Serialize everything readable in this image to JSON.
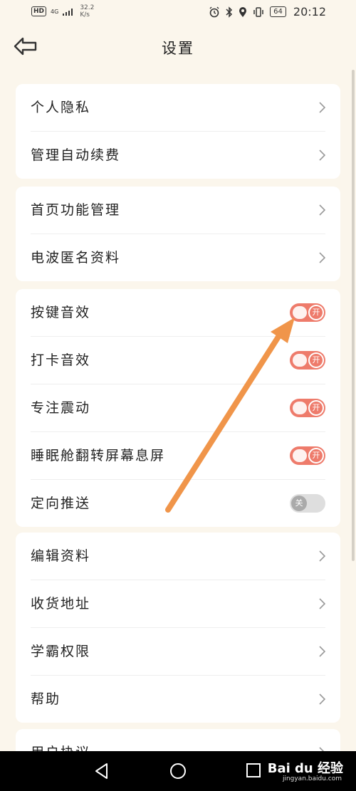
{
  "status_bar": {
    "hd": "HD",
    "network": "4G",
    "speed_value": "32.2",
    "speed_unit": "K/s",
    "battery": "64",
    "time": "20:12"
  },
  "header": {
    "title": "设置"
  },
  "sections": [
    {
      "items": [
        {
          "label": "个人隐私"
        },
        {
          "label": "管理自动续费"
        }
      ]
    },
    {
      "items": [
        {
          "label": "首页功能管理"
        },
        {
          "label": "电波匿名资料"
        }
      ]
    },
    {
      "items": [
        {
          "label": "按键音效",
          "toggle_text": "开",
          "on": true
        },
        {
          "label": "打卡音效",
          "toggle_text": "开",
          "on": true
        },
        {
          "label": "专注震动",
          "toggle_text": "开",
          "on": true
        },
        {
          "label": "睡眠舱翻转屏幕息屏",
          "toggle_text": "开",
          "on": true
        },
        {
          "label": "定向推送",
          "toggle_text": "关",
          "on": false
        }
      ]
    },
    {
      "items": [
        {
          "label": "编辑资料"
        },
        {
          "label": "收货地址"
        },
        {
          "label": "学霸权限"
        },
        {
          "label": "帮助"
        }
      ]
    },
    {
      "items": [
        {
          "label": "用户协议"
        }
      ]
    }
  ],
  "annotation": {
    "color": "#f0954a"
  },
  "watermark": {
    "brand": "Bai du 经验",
    "url": "jingyan.baidu.com"
  }
}
